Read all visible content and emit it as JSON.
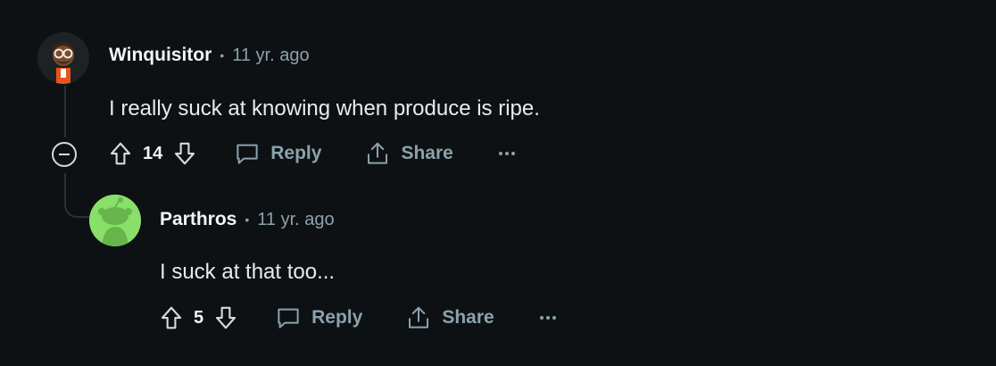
{
  "comments": [
    {
      "author": "Winquisitor",
      "separator": "•",
      "time": "11 yr. ago",
      "body": "I really suck at knowing when produce is ripe.",
      "score": "14",
      "reply_label": "Reply",
      "share_label": "Share"
    },
    {
      "author": "Parthros",
      "separator": "•",
      "time": "11 yr. ago",
      "body": "I suck at that too...",
      "score": "5",
      "reply_label": "Reply",
      "share_label": "Share"
    }
  ],
  "colors": {
    "background": "#0e1113",
    "meta_text": "#8ba2ad",
    "avatar_green": "#88e06a"
  },
  "icons": [
    "upvote-icon",
    "downvote-icon",
    "comment-icon",
    "share-icon",
    "more-icon",
    "collapse-icon"
  ]
}
